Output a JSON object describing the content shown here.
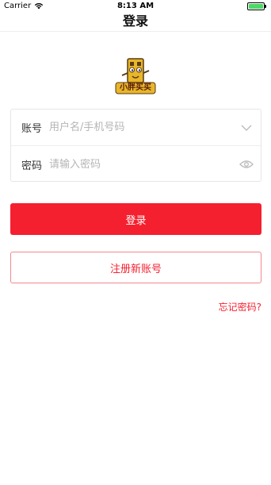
{
  "status_bar": {
    "carrier": "Carrier",
    "time": "8:13 AM",
    "battery_color": "#4cd964"
  },
  "nav": {
    "title": "登录"
  },
  "logo": {
    "text": "小胖买买",
    "icon": "logo-mascot-icon"
  },
  "form": {
    "account_label": "账号",
    "account_placeholder": "用户名/手机号码",
    "account_value": "",
    "account_icon": "chevron-down-icon",
    "password_label": "密码",
    "password_placeholder": "请输入密码",
    "password_value": "",
    "password_icon": "eye-icon"
  },
  "actions": {
    "login_label": "登录",
    "register_label": "注册新账号",
    "forgot_label": "忘记密码?"
  },
  "colors": {
    "accent": "#f5202f",
    "border": "#e6e6e6",
    "placeholder": "#b5b5b5"
  }
}
